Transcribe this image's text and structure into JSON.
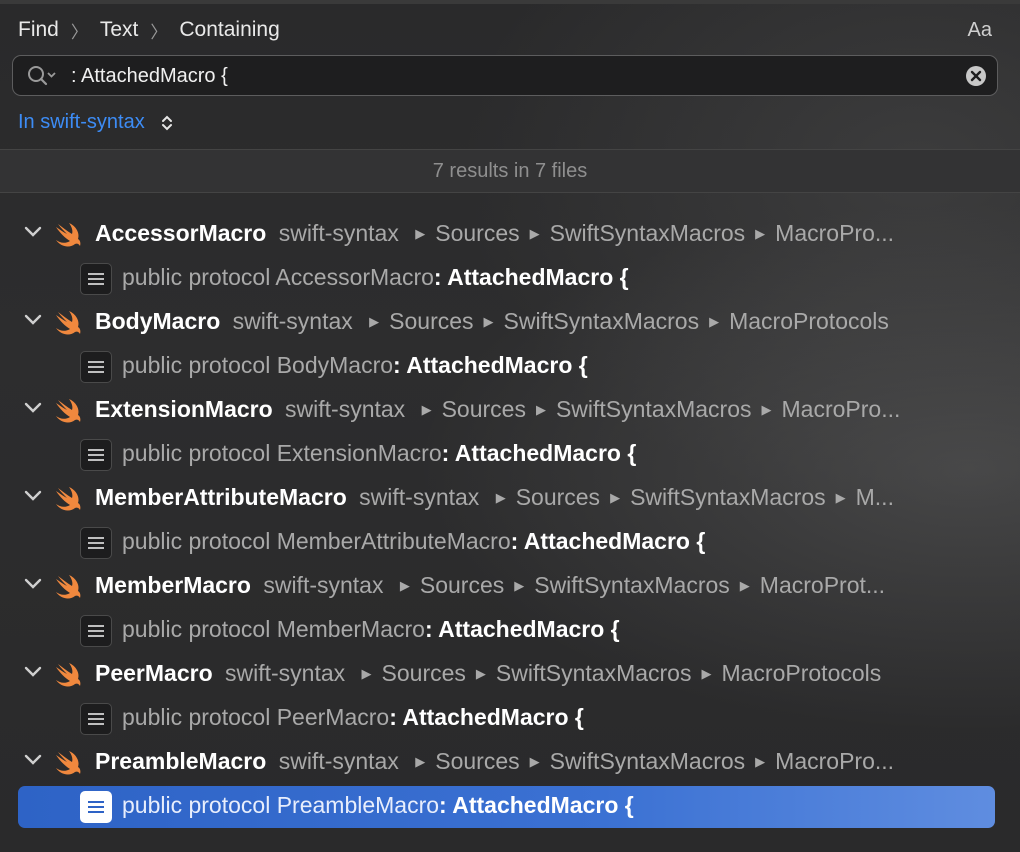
{
  "breadcrumb": {
    "items": [
      "Find",
      "Text",
      "Containing"
    ]
  },
  "case_toggle_label": "Aa",
  "search": {
    "value": ": AttachedMacro {",
    "placeholder": ""
  },
  "scope": {
    "label": "In swift-syntax"
  },
  "status": "7 results in 7 files",
  "colors": {
    "accent": "#3d8cf5",
    "swift_orange": "#f0883e",
    "selection": "#2e63c6"
  },
  "icons": {
    "search": "search-icon",
    "clear": "clear-icon",
    "file": "swift-file-icon",
    "match": "text-document-icon",
    "disclosure": "chevron-down-icon"
  },
  "results": [
    {
      "file": "AccessorMacro",
      "path": [
        "swift-syntax",
        "Sources",
        "SwiftSyntaxMacros",
        "MacroPro..."
      ],
      "prefix": "public protocol AccessorMacro",
      "match": ": AttachedMacro {",
      "selected": false
    },
    {
      "file": "BodyMacro",
      "path": [
        "swift-syntax",
        "Sources",
        "SwiftSyntaxMacros",
        "MacroProtocols"
      ],
      "prefix": "public protocol BodyMacro",
      "match": ": AttachedMacro {",
      "selected": false
    },
    {
      "file": "ExtensionMacro",
      "path": [
        "swift-syntax",
        "Sources",
        "SwiftSyntaxMacros",
        "MacroPro..."
      ],
      "prefix": "public protocol ExtensionMacro",
      "match": ": AttachedMacro {",
      "selected": false
    },
    {
      "file": "MemberAttributeMacro",
      "path": [
        "swift-syntax",
        "Sources",
        "SwiftSyntaxMacros",
        "M..."
      ],
      "prefix": "public protocol MemberAttributeMacro",
      "match": ": AttachedMacro {",
      "selected": false
    },
    {
      "file": "MemberMacro",
      "path": [
        "swift-syntax",
        "Sources",
        "SwiftSyntaxMacros",
        "MacroProt..."
      ],
      "prefix": "public protocol MemberMacro",
      "match": ": AttachedMacro {",
      "selected": false
    },
    {
      "file": "PeerMacro",
      "path": [
        "swift-syntax",
        "Sources",
        "SwiftSyntaxMacros",
        "MacroProtocols"
      ],
      "prefix": "public protocol PeerMacro",
      "match": ": AttachedMacro {",
      "selected": false
    },
    {
      "file": "PreambleMacro",
      "path": [
        "swift-syntax",
        "Sources",
        "SwiftSyntaxMacros",
        "MacroPro..."
      ],
      "prefix": "public protocol PreambleMacro",
      "match": ": AttachedMacro {",
      "selected": true
    }
  ]
}
